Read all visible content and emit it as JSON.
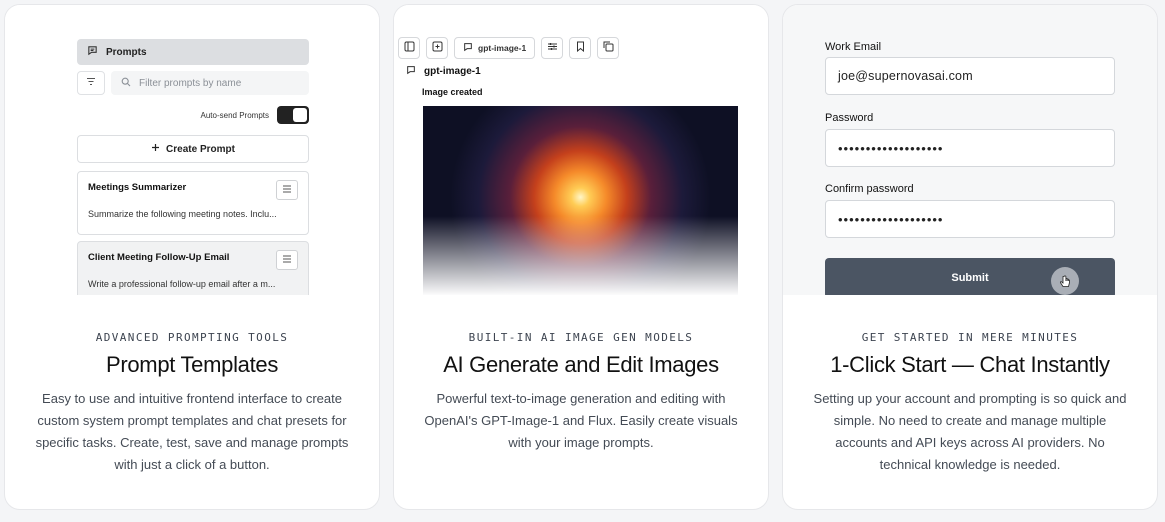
{
  "cards": [
    {
      "eyebrow": "ADVANCED PROMPTING TOOLS",
      "title": "Prompt Templates",
      "description": "Easy to use and intuitive frontend interface to create custom system prompt templates and chat presets for specific tasks. Create, test, save and manage prompts with just a click of a button.",
      "mock": {
        "header": "Prompts",
        "search_placeholder": "Filter prompts by name",
        "auto_send_label": "Auto-send Prompts",
        "create_label": "Create Prompt",
        "items": [
          {
            "name": "Meetings Summarizer",
            "preview": "Summarize the following meeting notes. Inclu..."
          },
          {
            "name": "Client Meeting Follow-Up Email",
            "preview": "Write a professional follow-up email after a m..."
          }
        ]
      }
    },
    {
      "eyebrow": "BUILT-IN AI IMAGE GEN MODELS",
      "title": "AI Generate and Edit Images",
      "description": "Powerful text-to-image generation and editing with OpenAI's GPT-Image-1 and Flux. Easily create visuals with your image prompts.",
      "mock": {
        "toolbar_model": "gpt-image-1",
        "model_name": "gpt-image-1",
        "status": "Image created"
      }
    },
    {
      "eyebrow": "GET STARTED IN MERE MINUTES",
      "title": "1-Click Start — Chat Instantly",
      "description": "Setting up your account and prompting is so quick and simple. No need to create and manage multiple accounts and API keys across AI providers. No technical knowledge is needed.",
      "mock": {
        "email_label": "Work Email",
        "email_value": "joe@supernovasai.com",
        "password_label": "Password",
        "password_value": "•••••••••••••••••••",
        "confirm_label": "Confirm password",
        "confirm_value": "•••••••••••••••••••",
        "submit_label": "Submit"
      }
    }
  ],
  "icons": {
    "prompts": "chat-icon",
    "filter": "filter-icon",
    "search": "search-icon",
    "create": "plus-icon",
    "menu": "menu-icon",
    "cursor": "hand-cursor-icon"
  }
}
